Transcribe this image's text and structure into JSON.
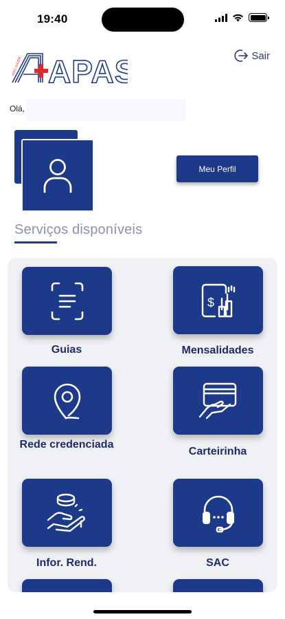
{
  "status_bar": {
    "time": "19:40"
  },
  "header": {
    "logo_text": "APAS",
    "logout_label": "Sair"
  },
  "greeting": "Olá,",
  "profile": {
    "button_label": "Meu Perfil"
  },
  "services": {
    "title": "Serviços disponíveis",
    "items": [
      {
        "label": "Guias",
        "icon": "document-scan-icon"
      },
      {
        "label": "Mensalidades",
        "icon": "invoice-chart-icon"
      },
      {
        "label": "Rede credenciada",
        "icon": "location-pin-icon"
      },
      {
        "label": "Carteirinha",
        "icon": "card-hand-icon"
      },
      {
        "label": "Infor. Rend.",
        "icon": "coins-hand-icon"
      },
      {
        "label": "SAC",
        "icon": "headset-icon"
      }
    ]
  },
  "colors": {
    "primary": "#1d3a8a",
    "logo_red": "#e02a2a",
    "panel_bg": "#f0f1f4"
  }
}
